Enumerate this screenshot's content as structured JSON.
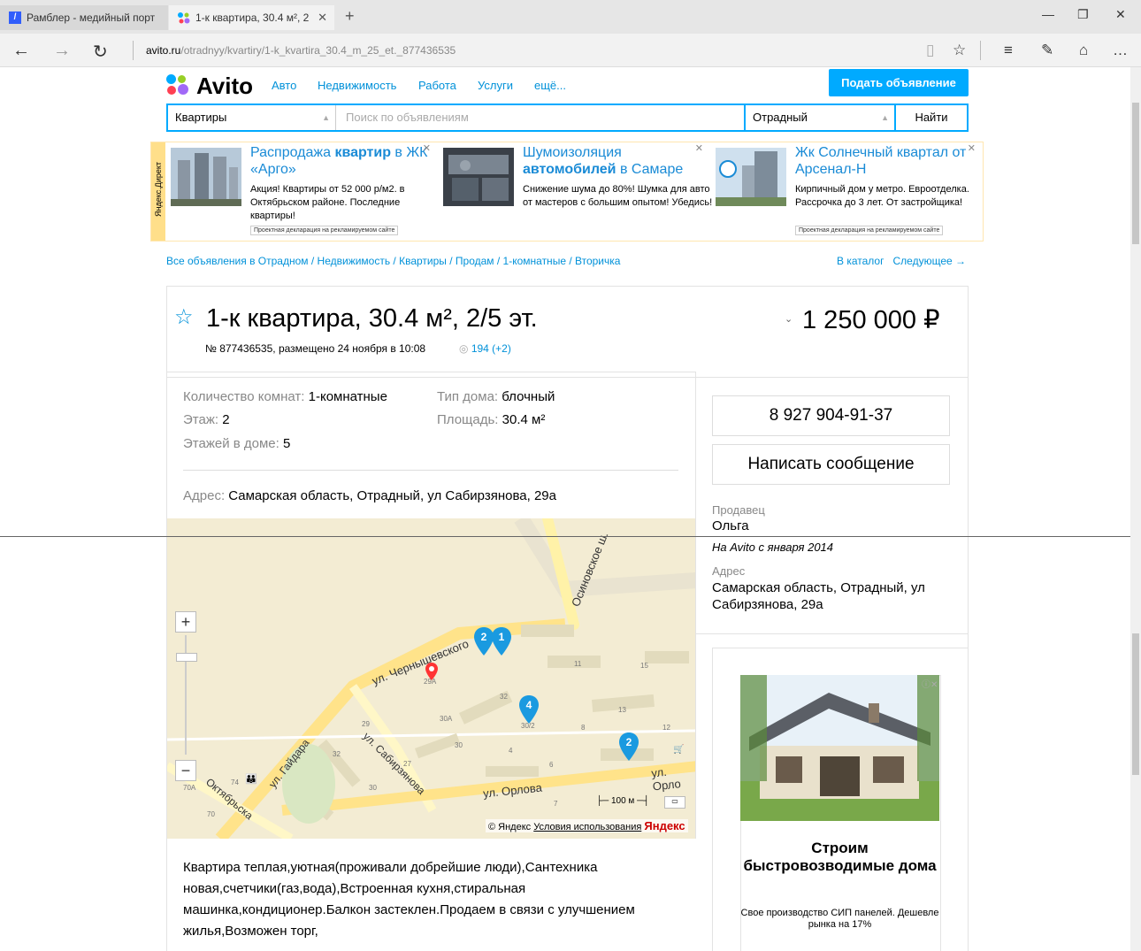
{
  "browser": {
    "tabs": [
      {
        "label": "Рамблер - медийный порт",
        "active": false
      },
      {
        "label": "1-к квартира, 30.4 м², 2",
        "active": true
      }
    ],
    "url_domain": "avito.ru",
    "url_path": "/otradnyy/kvartiry/1-k_kvartira_30.4_m_25_et._877436535"
  },
  "header": {
    "logo": "Avito",
    "nav": [
      "Авто",
      "Недвижимость",
      "Работа",
      "Услуги",
      "ещё..."
    ],
    "post_button": "Подать объявление"
  },
  "search": {
    "category": "Квартиры",
    "placeholder": "Поиск по объявлениям",
    "location": "Отрадный",
    "button": "Найти"
  },
  "ads": {
    "side_label": "Яндекс.Директ",
    "items": [
      {
        "title_1": "Распродажа ",
        "title_b": "квартир",
        "title_2": " в ЖК «Арго»",
        "text": "Акция! Квартиры от 52 000 р/м2. в Октябрьском районе. Последние квартиры!",
        "tag": "Проектная декларация на рекламируемом сайте"
      },
      {
        "title_1": "Шумоизоляция ",
        "title_b": "автомобилей",
        "title_2": " в Самаре",
        "text": "Снижение шума до 80%! Шумка для авто от мастеров с большим опытом! Убедись!",
        "tag": ""
      },
      {
        "title_1": "Жк Солнечный квартал от Арсенал-Н",
        "title_b": "",
        "title_2": "",
        "text": "Кирпичный дом у метро. Евроотделка. Рассрочка до 3 лет. От застройщика!",
        "tag": "Проектная декларация на рекламируемом сайте"
      }
    ]
  },
  "breadcrumbs": "Все объявления в Отрадном / Недвижимость / Квартиры / Продам / 1-комнатные / Вторичка",
  "breadcrumbs_right": {
    "catalog": "В каталог",
    "next": "Следующее →"
  },
  "listing": {
    "title": "1-к квартира, 30.4 м², 2/5 эт.",
    "meta": "№ 877436535, размещено 24 ноября в 10:08",
    "views": "194 (+2)",
    "price": "1 250 000 ₽",
    "params": {
      "rooms_label": "Количество комнат:",
      "rooms": "1-комнатные",
      "floor_label": "Этаж:",
      "floor": "2",
      "floors_label": "Этажей в доме:",
      "floors": "5",
      "house_label": "Тип дома:",
      "house": "блочный",
      "area_label": "Площадь:",
      "area": "30.4 м²",
      "address_label": "Адрес:",
      "address": "Самарская область, Отрадный, ул Сабирзянова, 29а"
    },
    "description": "Квартира теплая,уютная(проживали добрейшие люди),Сантехника новая,счетчики(газ,вода),Встроенная кухня,стиральная машинка,кондиционер.Балкон застеклен.Продаем в связи с улучшением жилья,Возможен торг,"
  },
  "contact": {
    "phone": "8 927 904-91-37",
    "message_button": "Написать сообщение",
    "seller_label": "Продавец",
    "seller": "Ольга",
    "since": "На Avito с января 2014",
    "address_label": "Адрес",
    "address": "Самарская область, Отрадный, ул Сабирзянова, 29а"
  },
  "map": {
    "copyright": "© Яндекс",
    "terms": "Условия использования",
    "brand": "Яндекс",
    "scale": "100 м",
    "streets": [
      "Осиновское ш.",
      "ул. Чернышевского",
      "ул. Гайдара",
      "ул. Сабирзянова",
      "ул. Орлова",
      "ул. Орло",
      "Октябрьска"
    ],
    "houses": [
      "11",
      "15",
      "13",
      "12",
      "8",
      "6",
      "7",
      "4",
      "32",
      "30А",
      "30",
      "29",
      "27",
      "32",
      "30",
      "74",
      "70",
      "70А",
      "29А",
      "30/2"
    ],
    "markers": [
      "2",
      "1",
      "4",
      "2"
    ]
  },
  "right_ad": {
    "headline": "Строим быстровозводимые дома",
    "text": "Свое производство СИП панелей. Дешевле рынка на 17%"
  }
}
